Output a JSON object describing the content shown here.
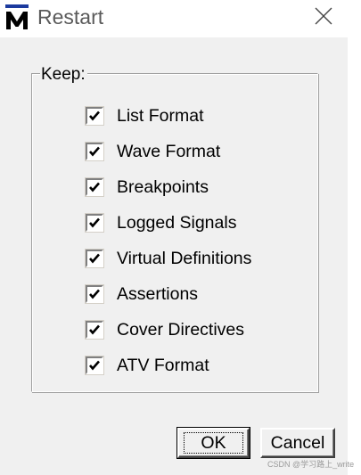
{
  "window": {
    "title": "Restart",
    "app_icon": "modelsim-m-icon",
    "close_icon": "close-icon"
  },
  "group": {
    "legend": "Keep:",
    "items": [
      {
        "label": "List Format",
        "checked": true
      },
      {
        "label": "Wave Format",
        "checked": true
      },
      {
        "label": "Breakpoints",
        "checked": true
      },
      {
        "label": "Logged Signals",
        "checked": true
      },
      {
        "label": "Virtual Definitions",
        "checked": true
      },
      {
        "label": "Assertions",
        "checked": true
      },
      {
        "label": "Cover Directives",
        "checked": true
      },
      {
        "label": "ATV Format",
        "checked": true
      }
    ]
  },
  "buttons": {
    "ok_label": "OK",
    "cancel_label": "Cancel"
  },
  "watermark": "CSDN @学习路上_write",
  "colors": {
    "dialog_bg": "#f0f0f0",
    "titlebar_bg": "#ffffff",
    "icon_blue": "#1c3a9e"
  }
}
